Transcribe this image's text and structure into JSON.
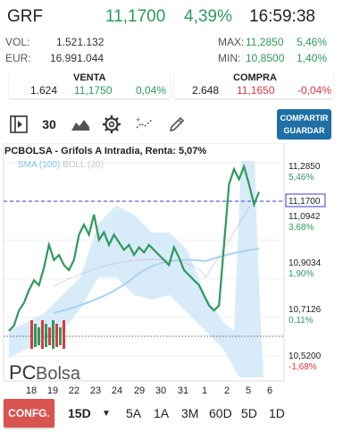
{
  "header": {
    "ticker": "GRF",
    "price": "11,1700",
    "change_pct": "4,39%",
    "time": "16:59:38"
  },
  "stats": {
    "vol_label": "VOL:",
    "vol_value": "1.521.132",
    "eur_label": "EUR:",
    "eur_value": "16.991.044",
    "max_label": "MAX:",
    "max_value": "11,2850",
    "max_pct": "5,46%",
    "min_label": "MIN:",
    "min_value": "10,8500",
    "min_pct": "1,40%"
  },
  "venta": {
    "title": "VENTA",
    "qty": "1.624",
    "price": "11,1750",
    "pct": "0,04%"
  },
  "compra": {
    "title": "COMPRA",
    "qty": "2.648",
    "price": "11,1650",
    "pct": "-0,04%"
  },
  "toolbar": {
    "interval": "30",
    "share_line1": "COMPARTIR",
    "share_line2": "GUARDAR"
  },
  "colors": {
    "green": "#2e9a5c",
    "red": "#e0373d",
    "blue": "#1e6fa6",
    "config": "#d9534f"
  },
  "chart": {
    "title": "PCBOLSA - Grifols A Intradia, Renta: 5,07%",
    "sma_label": "SMA (100)",
    "boll_label": "BOLL (20)",
    "watermark_pc": "PC",
    "watermark_bolsa": "Bolsa",
    "right_labels": [
      {
        "price": "11,2850",
        "pct": "5,46%",
        "pct_color": "#2e9a5c"
      },
      {
        "price": "11,1700",
        "pct": "",
        "pct_color": "#2e9a5c"
      },
      {
        "price": "11,0942",
        "pct": "3,68%",
        "pct_color": "#2e9a5c"
      },
      {
        "price": "10,9034",
        "pct": "1,90%",
        "pct_color": "#2e9a5c"
      },
      {
        "price": "10,7126",
        "pct": "0,11%",
        "pct_color": "#2e9a5c"
      },
      {
        "price": "10,5200",
        "pct": "-1,68%",
        "pct_color": "#e0373d"
      }
    ],
    "x_ticks": [
      "18",
      "19",
      "22",
      "23",
      "24",
      "29",
      "30",
      "31",
      "1",
      "2",
      "5",
      "6"
    ]
  },
  "chart_data": {
    "type": "line",
    "series": [
      {
        "values": [
          10.62,
          10.64,
          10.7,
          10.73,
          10.78,
          10.82,
          10.8,
          10.87,
          10.96,
          10.9,
          10.92,
          10.88,
          10.86,
          10.9,
          11.0,
          11.04,
          11.0,
          11.08,
          10.98,
          11.01,
          10.96,
          11.0,
          10.97,
          10.94,
          10.96,
          10.92,
          10.95,
          10.93,
          10.96,
          10.94,
          10.92,
          10.9,
          10.88,
          10.95,
          10.91,
          10.86,
          10.84,
          10.82,
          10.8,
          10.76,
          10.72,
          10.7,
          10.72,
          10.96,
          11.2,
          11.26,
          11.22,
          11.27,
          11.2,
          11.12,
          11.17
        ]
      }
    ],
    "ylim": [
      10.52,
      11.285
    ],
    "xlabel": "",
    "ylabel": "",
    "grid": true
  },
  "bottom": {
    "config": "CONFG.",
    "periods": [
      "15D",
      "5A",
      "1A",
      "3M",
      "60D",
      "5D",
      "1D"
    ]
  }
}
